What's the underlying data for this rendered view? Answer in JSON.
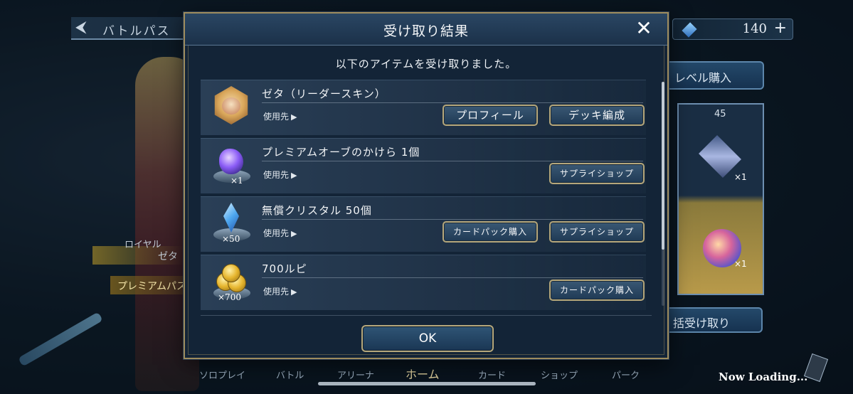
{
  "background": {
    "screen_title": "バトルパス",
    "currency_value": "140",
    "currency_plus": "+",
    "level_purchase_label": "レベル購入",
    "pass_level": "45",
    "reward_qty_1": "×1",
    "reward_qty_2": "×1",
    "bulk_receive_label": "括受け取り",
    "character_class": "ロイヤル",
    "character_name": "ゼタ",
    "premium_label": "プレミアムパス",
    "nav": [
      "ソロプレイ",
      "バトル",
      "アリーナ",
      "ホーム",
      "カード",
      "ショップ",
      "パーク"
    ],
    "loading_text": "Now Loading..."
  },
  "dialog": {
    "title": "受け取り結果",
    "close_symbol": "✕",
    "subtitle": "以下のアイテムを受け取りました。",
    "use_label": "使用先",
    "items": [
      {
        "name": "ゼタ（リーダースキン）",
        "qty": "",
        "buttons": [
          "プロフィール",
          "デッキ編成"
        ]
      },
      {
        "name": "プレミアムオーブのかけら 1個",
        "qty": "×1",
        "buttons": [
          "サプライショップ"
        ]
      },
      {
        "name": "無償クリスタル 50個",
        "qty": "×50",
        "buttons": [
          "カードパック購入",
          "サプライショップ"
        ]
      },
      {
        "name": "700ルピ",
        "qty": "×700",
        "buttons": [
          "カードパック購入"
        ]
      }
    ],
    "ok_label": "OK"
  }
}
